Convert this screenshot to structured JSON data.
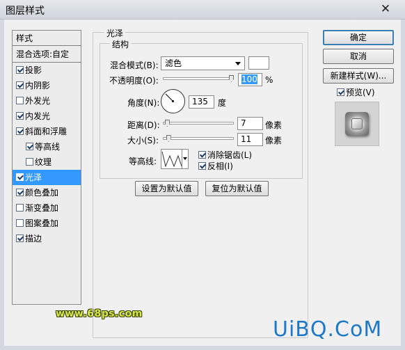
{
  "window": {
    "title": "图层样式",
    "close_glyph": "✕"
  },
  "style_list": {
    "header": "样式",
    "blend_options": "混合选项:自定",
    "items": [
      {
        "label": "投影",
        "checked": true,
        "sub": false,
        "selected": false
      },
      {
        "label": "内阴影",
        "checked": true,
        "sub": false,
        "selected": false
      },
      {
        "label": "外发光",
        "checked": false,
        "sub": false,
        "selected": false
      },
      {
        "label": "内发光",
        "checked": true,
        "sub": false,
        "selected": false
      },
      {
        "label": "斜面和浮雕",
        "checked": true,
        "sub": false,
        "selected": false
      },
      {
        "label": "等高线",
        "checked": true,
        "sub": true,
        "selected": false
      },
      {
        "label": "纹理",
        "checked": false,
        "sub": true,
        "selected": false
      },
      {
        "label": "光泽",
        "checked": true,
        "sub": false,
        "selected": true
      },
      {
        "label": "颜色叠加",
        "checked": true,
        "sub": false,
        "selected": false
      },
      {
        "label": "渐变叠加",
        "checked": false,
        "sub": false,
        "selected": false
      },
      {
        "label": "图案叠加",
        "checked": false,
        "sub": false,
        "selected": false
      },
      {
        "label": "描边",
        "checked": true,
        "sub": false,
        "selected": false
      }
    ]
  },
  "panel": {
    "group_title": "光泽",
    "structure_title": "结构",
    "blend_mode_label": "混合模式(B):",
    "blend_mode_value": "滤色",
    "opacity_label": "不透明度(O):",
    "opacity_value": "100",
    "opacity_unit": "%",
    "opacity_fraction": 1.0,
    "angle_label": "角度(N):",
    "angle_value": "135",
    "angle_unit": "度",
    "distance_label": "距离(D):",
    "distance_value": "7",
    "distance_unit": "像素",
    "distance_fraction": 0.03,
    "size_label": "大小(S):",
    "size_value": "11",
    "size_unit": "像素",
    "size_fraction": 0.05,
    "contour_label": "等高线:",
    "antialias_label": "消除锯齿(L)",
    "antialias_checked": true,
    "invert_label": "反相(I)",
    "invert_checked": true,
    "make_default": "设置为默认值",
    "reset_default": "复位为默认值"
  },
  "right": {
    "ok": "确定",
    "cancel": "取消",
    "new_style": "新建样式(W)...",
    "preview_label": "预览(V)",
    "preview_checked": true
  },
  "watermarks": {
    "left": "www.68ps.com",
    "right": "UiBQ.CoM"
  },
  "colors": {
    "selection": "#3399ff",
    "default_button_border": "#3c7fb1",
    "swatch": "#ffffff"
  }
}
